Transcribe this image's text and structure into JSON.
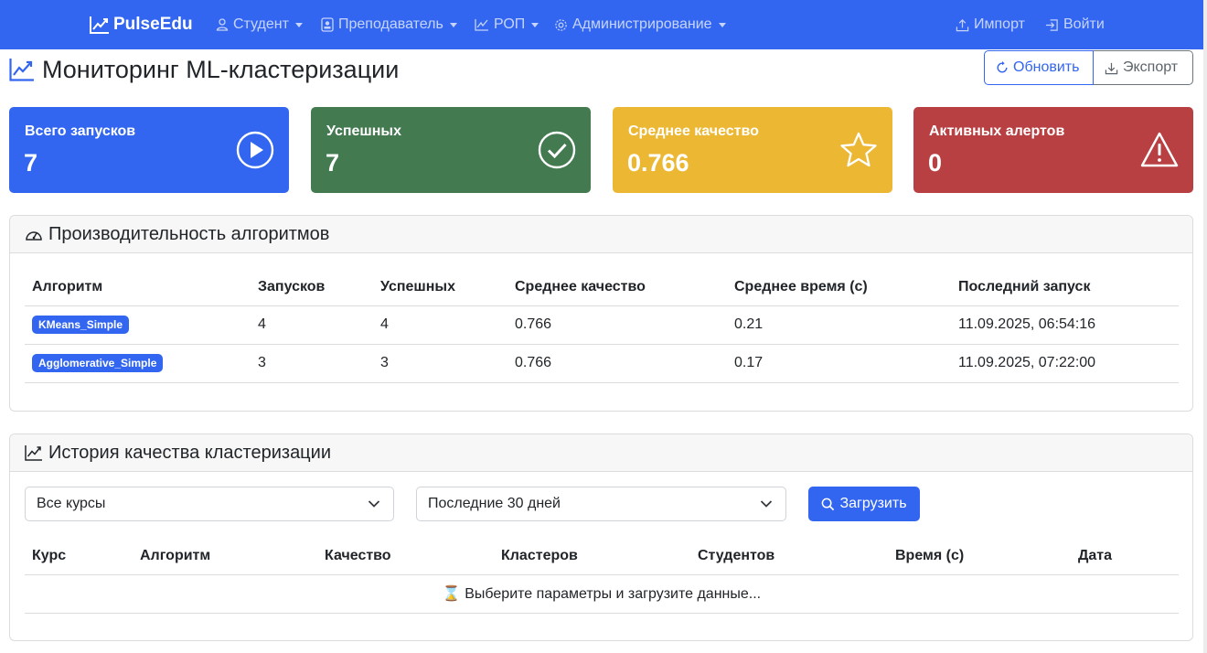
{
  "nav": {
    "brand": "PulseEdu",
    "items": [
      {
        "label": "Студент",
        "icon": "person-icon"
      },
      {
        "label": "Преподаватель",
        "icon": "badge-icon"
      },
      {
        "label": "РОП",
        "icon": "chart-icon"
      },
      {
        "label": "Администрирование",
        "icon": "gear-icon"
      }
    ],
    "import_label": "Импорт",
    "login_label": "Войти"
  },
  "header": {
    "title": "Мониторинг ML-кластеризации",
    "refresh_label": "Обновить",
    "export_label": "Экспорт"
  },
  "stats": [
    {
      "label": "Всего запусков",
      "value": "7",
      "color": "#3366f0",
      "icon": "play-circle-icon"
    },
    {
      "label": "Успешных",
      "value": "7",
      "color": "#447a50",
      "icon": "check-circle-icon"
    },
    {
      "label": "Среднее качество",
      "value": "0.766",
      "color": "#ecb833",
      "icon": "star-icon"
    },
    {
      "label": "Активных алертов",
      "value": "0",
      "color": "#b94042",
      "icon": "warning-icon"
    }
  ],
  "performance": {
    "title": "Производительность алгоритмов",
    "columns": [
      "Алгоритм",
      "Запусков",
      "Успешных",
      "Среднее качество",
      "Среднее время (с)",
      "Последний запуск"
    ],
    "rows": [
      {
        "algorithm": "KMeans_Simple",
        "runs": "4",
        "successful": "4",
        "quality": "0.766",
        "time": "0.21",
        "last_run": "11.09.2025, 06:54:16"
      },
      {
        "algorithm": "Agglomerative_Simple",
        "runs": "3",
        "successful": "3",
        "quality": "0.766",
        "time": "0.17",
        "last_run": "11.09.2025, 07:22:00"
      }
    ]
  },
  "history": {
    "title": "История качества кластеризации",
    "course_select": "Все курсы",
    "period_select": "Последние 30 дней",
    "load_label": "Загрузить",
    "columns": [
      "Курс",
      "Алгоритм",
      "Качество",
      "Кластеров",
      "Студентов",
      "Время (с)",
      "Дата"
    ],
    "empty_message": "⌛ Выберите параметры и загрузите данные..."
  }
}
